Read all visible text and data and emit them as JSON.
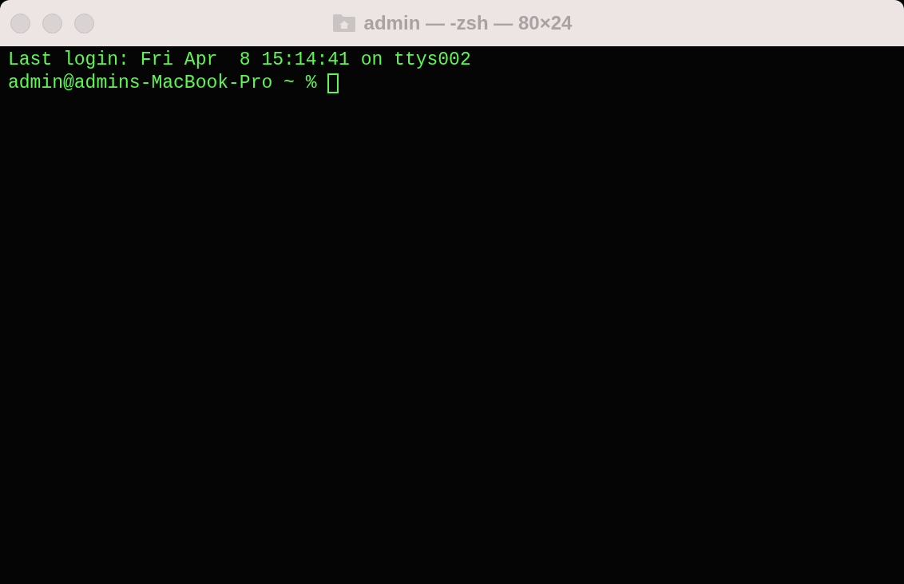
{
  "window": {
    "title": "admin — -zsh — 80×24",
    "focused": false
  },
  "terminal": {
    "lines": [
      {
        "kind": "output",
        "text": "Last login: Fri Apr  8 15:14:41 on ttys002"
      },
      {
        "kind": "prompt",
        "text": "admin@admins-MacBook-Pro ~ % "
      }
    ]
  }
}
